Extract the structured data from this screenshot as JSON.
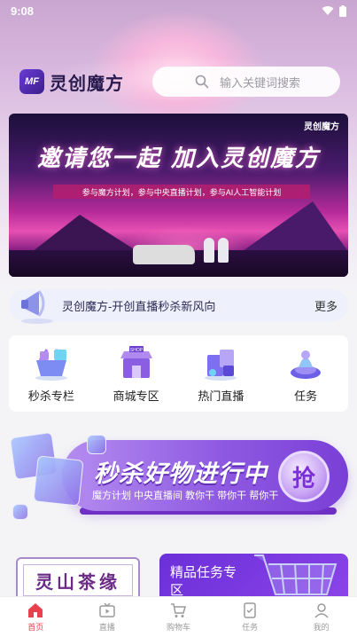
{
  "status_bar": {
    "time": "9:08"
  },
  "header": {
    "logo_mark": "MF",
    "logo_text": "灵创魔方",
    "search_placeholder": "输入关键词搜索"
  },
  "banner": {
    "brand": "灵创魔方",
    "headline": "邀请您一起 加入灵创魔方",
    "subtitle": "参与魔方计划，参与中央直播计划，参与AI人工智能计划"
  },
  "notice": {
    "text": "灵创魔方-开创直播秒杀新风向",
    "more": "更多"
  },
  "quick_links": [
    {
      "label": "秒杀专栏",
      "icon": "flash-sale-basket-icon"
    },
    {
      "label": "商城专区",
      "icon": "shop-icon"
    },
    {
      "label": "热门直播",
      "icon": "live-stream-icon"
    },
    {
      "label": "任务",
      "icon": "task-icon"
    }
  ],
  "flash_sale": {
    "title": "秒杀好物进行中",
    "description": "魔方计划 中央直播间 教你干 带你干 帮你干",
    "grab_button": "抢"
  },
  "cards": {
    "left_title": "灵山茶缘",
    "right_title": "精品任务专区"
  },
  "tabbar": [
    {
      "label": "首页",
      "icon": "home-icon",
      "active": true
    },
    {
      "label": "直播",
      "icon": "tv-icon",
      "active": false
    },
    {
      "label": "购物车",
      "icon": "cart-icon",
      "active": false
    },
    {
      "label": "任务",
      "icon": "task-list-icon",
      "active": false
    },
    {
      "label": "我的",
      "icon": "user-icon",
      "active": false
    }
  ],
  "colors": {
    "accent": "#e8424f",
    "brand_purple": "#7a3fd6"
  }
}
